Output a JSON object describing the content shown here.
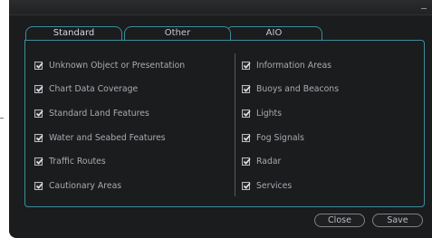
{
  "tabs": [
    {
      "label": "Standard",
      "active": true
    },
    {
      "label": "Other",
      "active": false
    },
    {
      "label": "AIO",
      "active": false
    }
  ],
  "left_items": [
    {
      "label": "Unknown Object or Presentation",
      "checked": true
    },
    {
      "label": "Chart Data Coverage",
      "checked": true
    },
    {
      "label": "Standard Land Features",
      "checked": true
    },
    {
      "label": "Water and Seabed Features",
      "checked": true
    },
    {
      "label": "Traffic Routes",
      "checked": true
    },
    {
      "label": "Cautionary Areas",
      "checked": true
    }
  ],
  "right_items": [
    {
      "label": "Information Areas",
      "checked": true
    },
    {
      "label": "Buoys and Beacons",
      "checked": true
    },
    {
      "label": "Lights",
      "checked": true
    },
    {
      "label": "Fog Signals",
      "checked": true
    },
    {
      "label": "Radar",
      "checked": true
    },
    {
      "label": "Services",
      "checked": true
    }
  ],
  "buttons": {
    "close_label": "Close",
    "save_label": "Save"
  },
  "colors": {
    "accent": "#3d8e9c",
    "background": "#1a1c1e",
    "text": "#a8acb0"
  }
}
